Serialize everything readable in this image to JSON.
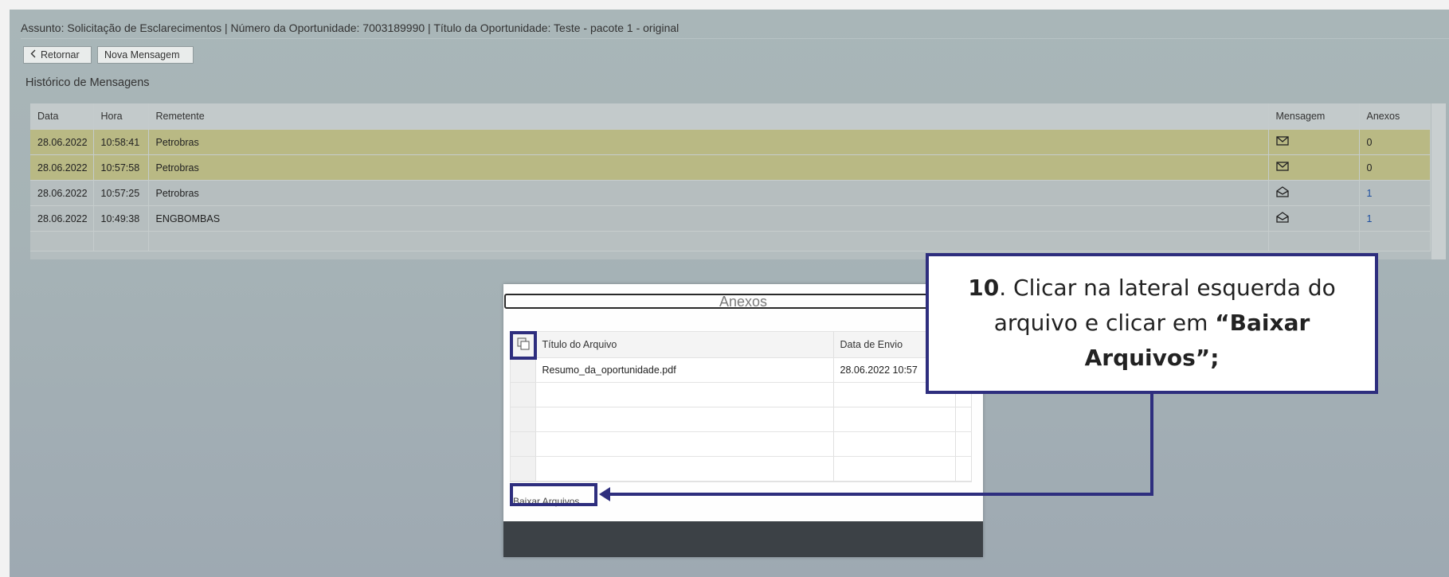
{
  "header": {
    "subject_line": "Assunto: Solicitação de Esclarecimentos | Número da Oportunidade: 7003189990 | Título da Oportunidade: Teste - pacote 1 - original"
  },
  "toolbar": {
    "back_label": "Retornar",
    "back_icon": "chevron-left-icon",
    "new_message_label": "Nova Mensagem"
  },
  "history": {
    "title": "Histórico de Mensagens",
    "columns": {
      "date": "Data",
      "time": "Hora",
      "sender": "Remetente",
      "message": "Mensagem",
      "attachments": "Anexos"
    },
    "rows": [
      {
        "date": "28.06.2022",
        "time": "10:58:41",
        "sender": "Petrobras",
        "message_icon": "envelope-closed-icon",
        "attachments": "0",
        "highlight": true
      },
      {
        "date": "28.06.2022",
        "time": "10:57:58",
        "sender": "Petrobras",
        "message_icon": "envelope-closed-icon",
        "attachments": "0",
        "highlight": true
      },
      {
        "date": "28.06.2022",
        "time": "10:57:25",
        "sender": "Petrobras",
        "message_icon": "envelope-open-icon",
        "attachments": "1",
        "highlight": false
      },
      {
        "date": "28.06.2022",
        "time": "10:49:38",
        "sender": "ENGBOMBAS",
        "message_icon": "envelope-open-icon",
        "attachments": "1",
        "highlight": false
      }
    ]
  },
  "dialog": {
    "title": "Anexos",
    "columns": {
      "file_title": "Título do Arquivo",
      "sent_date": "Data de Envio"
    },
    "rows": [
      {
        "file_title": "Resumo_da_oportunidade.pdf",
        "sent_date": "28.06.2022 10:57"
      }
    ],
    "download_label": "Baixar Arquivos",
    "select_all_icon": "select-all-icon"
  },
  "annotation": {
    "step": "10",
    "text_part1": ". Clicar na lateral esquerda do arquivo e clicar em ",
    "text_bold": "“Baixar Arquivos”;",
    "color": "#2e2e7e"
  },
  "colors": {
    "highlight_row": "#b9b984",
    "background": "#a9b6b8",
    "link": "#1e4fa0"
  }
}
